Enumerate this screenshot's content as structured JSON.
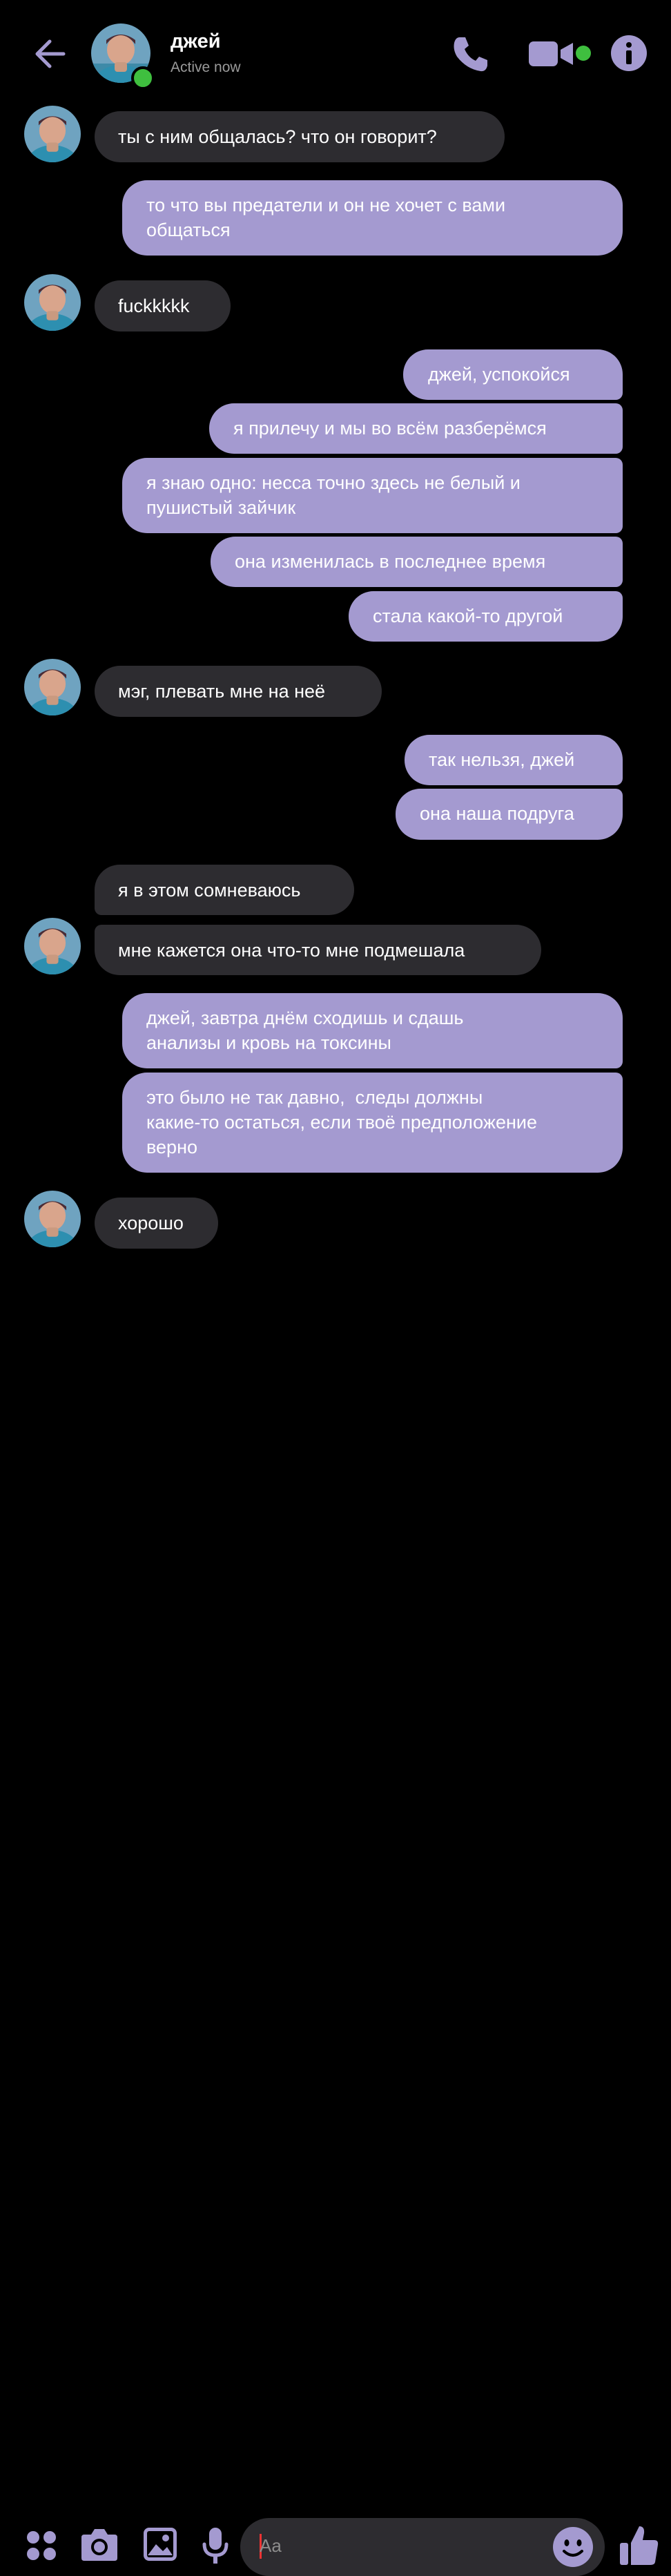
{
  "header": {
    "contact_name": "джей",
    "status": "Active now",
    "back_icon": "arrow-left-icon",
    "call_icon": "phone-icon",
    "video_icon": "video-camera-icon",
    "info_icon": "info-icon"
  },
  "messages": [
    {
      "from": "contact",
      "text": "ты с ним общалась? что он говорит?"
    },
    {
      "from": "me",
      "text": "то что вы предатели и он не хочет с вами\nобщаться"
    },
    {
      "from": "contact",
      "text": "fuckkkkk"
    },
    {
      "from": "me",
      "text": "джей, успокойся"
    },
    {
      "from": "me",
      "text": "я прилечу и мы во всём разберёмся"
    },
    {
      "from": "me",
      "text": "я знаю одно: несса точно здесь не белый и\nпушистый зайчик"
    },
    {
      "from": "me",
      "text": "она изменилась в последнее время"
    },
    {
      "from": "me",
      "text": "стала какой-то другой"
    },
    {
      "from": "contact",
      "text": "мэг, плевать мне на неё"
    },
    {
      "from": "me",
      "text": "так нельзя, джей"
    },
    {
      "from": "me",
      "text": "она наша подруга"
    },
    {
      "from": "contact",
      "text": "я в этом сомневаюсь"
    },
    {
      "from": "contact",
      "text": "мне кажется она что-то мне подмешала"
    },
    {
      "from": "me",
      "text": "джей, завтра днём сходишь и сдашь\nанализы и кровь на токсины"
    },
    {
      "from": "me",
      "text": "это было не так давно,  следы должны\nкакие-то остаться, если твоё предположение\nверно"
    },
    {
      "from": "contact",
      "text": "хорошо"
    }
  ],
  "composer": {
    "placeholder": "Aa",
    "menu_icon": "grid-dots-icon",
    "camera_icon": "camera-icon",
    "gallery_icon": "image-icon",
    "mic_icon": "microphone-icon",
    "emoji_icon": "smiley-icon",
    "like_icon": "thumbs-up-icon"
  },
  "colors": {
    "accent": "#a49ad0",
    "incoming_bubble": "#2d2c30",
    "online": "#3fbf3f",
    "background": "#000000"
  }
}
